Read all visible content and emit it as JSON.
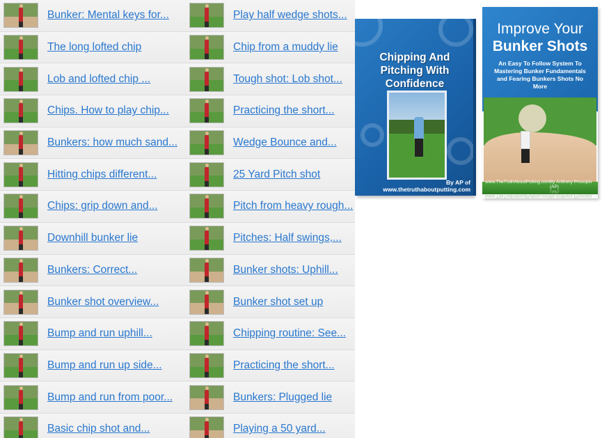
{
  "videos_left": [
    {
      "title": "Bunker: Mental keys for...",
      "thumb": "bunker"
    },
    {
      "title": "The long lofted chip",
      "thumb": "grass"
    },
    {
      "title": "Lob and lofted chip ...",
      "thumb": "grass"
    },
    {
      "title": "Chips. How to play chip...",
      "thumb": "grass"
    },
    {
      "title": "Bunkers: how much sand...",
      "thumb": "bunker"
    },
    {
      "title": "Hitting chips different...",
      "thumb": "grass"
    },
    {
      "title": "Chips: grip down and...",
      "thumb": "grass"
    },
    {
      "title": "Downhill bunker lie",
      "thumb": "bunker"
    },
    {
      "title": "Bunkers: Correct...",
      "thumb": "bunker"
    },
    {
      "title": "Bunker shot overview...",
      "thumb": "bunker"
    },
    {
      "title": "Bump and run uphill...",
      "thumb": "grass"
    },
    {
      "title": "Bump and run up side...",
      "thumb": "grass"
    },
    {
      "title": "Bump and run from poor...",
      "thumb": "grass"
    },
    {
      "title": "Basic chip shot and...",
      "thumb": "grass"
    }
  ],
  "videos_right": [
    {
      "title": "Play half wedge shots...",
      "thumb": "grass"
    },
    {
      "title": "Chip from a muddy lie",
      "thumb": "grass"
    },
    {
      "title": "Tough shot: Lob shot...",
      "thumb": "grass"
    },
    {
      "title": "Practicing the short...",
      "thumb": "grass"
    },
    {
      "title": "Wedge Bounce and...",
      "thumb": "grass"
    },
    {
      "title": "25 Yard Pitch shot",
      "thumb": "grass"
    },
    {
      "title": "Pitch from heavy rough...",
      "thumb": "grass"
    },
    {
      "title": "Pitches: Half swings,...",
      "thumb": "grass"
    },
    {
      "title": "Bunker shots: Uphill...",
      "thumb": "bunker"
    },
    {
      "title": "Bunker shot set up",
      "thumb": "bunker"
    },
    {
      "title": "Chipping routine: See...",
      "thumb": "grass"
    },
    {
      "title": "Practicing the short...",
      "thumb": "grass"
    },
    {
      "title": "Bunkers: Plugged lie",
      "thumb": "bunker"
    },
    {
      "title": "Playing a 50 yard...",
      "thumb": "bunker"
    }
  ],
  "book1": {
    "title": "Chipping And Pitching With Confidence",
    "byline": "By AP of www.thetruthaboutputting.com"
  },
  "book2": {
    "title_line1": "Improve Your",
    "title_line2": "Bunker Shots",
    "subtitle": "An Easy To Follow System To Mastering Bunker Fundamentals and Fearing Bunkers Shots No More",
    "footer_left": "www.TheTruthAboutPutting.com",
    "footer_right": "By Anthony Procopio (AP)"
  },
  "colors": {
    "link": "#2a78cf",
    "grass": "#5a9a3e",
    "sand": "#cdb08c"
  }
}
